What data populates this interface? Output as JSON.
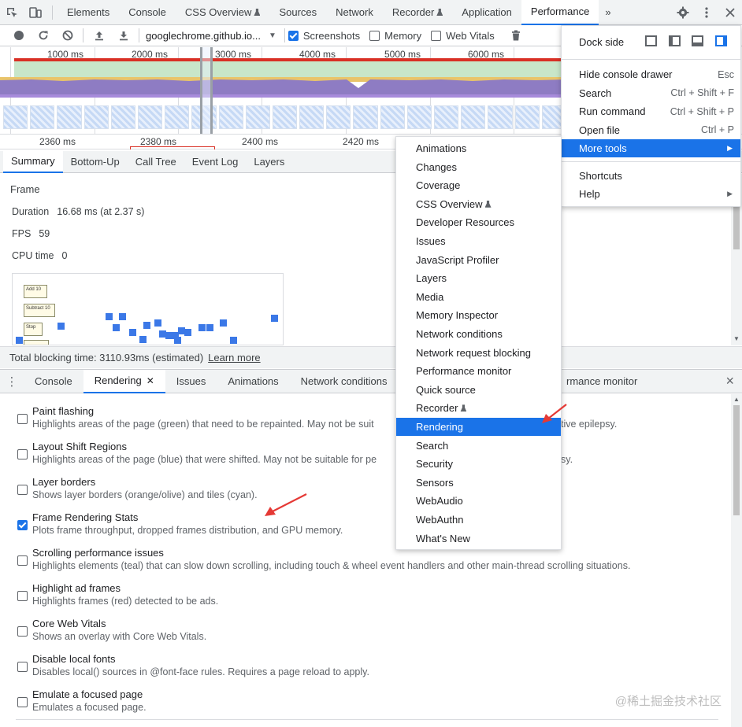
{
  "tabbar": {
    "tabs": [
      {
        "label": "Elements",
        "active": false
      },
      {
        "label": "Console",
        "active": false
      },
      {
        "label": "CSS Overview",
        "experimental": true,
        "active": false
      },
      {
        "label": "Sources",
        "active": false
      },
      {
        "label": "Network",
        "active": false
      },
      {
        "label": "Recorder",
        "experimental": true,
        "active": false
      },
      {
        "label": "Application",
        "active": false
      },
      {
        "label": "Performance",
        "active": true
      }
    ],
    "more": "»"
  },
  "perf_toolbar": {
    "url": "googlechrome.github.io...",
    "screenshots_label": "Screenshots",
    "screenshots_checked": true,
    "memory_label": "Memory",
    "memory_checked": false,
    "webvitals_label": "Web Vitals",
    "webvitals_checked": false
  },
  "overview_ruler": [
    "1000 ms",
    "2000 ms",
    "3000 ms",
    "4000 ms",
    "5000 ms",
    "6000 ms"
  ],
  "detail_ruler": [
    "2360 ms",
    "2380 ms",
    "2400 ms",
    "2420 ms"
  ],
  "subtabs": [
    "Summary",
    "Bottom-Up",
    "Call Tree",
    "Event Log",
    "Layers"
  ],
  "summary": {
    "heading": "Frame",
    "duration_label": "Duration",
    "duration_value": "16.68 ms (at 2.37 s)",
    "fps_label": "FPS",
    "fps_value": "59",
    "cpu_label": "CPU time",
    "cpu_value": "0",
    "thumb_buttons": [
      "Add 10",
      "Subtract 10",
      "Stop"
    ]
  },
  "footer": {
    "tbt_text": "Total blocking time: 3110.93ms (estimated)",
    "learn_more": "Learn more"
  },
  "drawer": {
    "tabs": [
      {
        "label": "Console",
        "active": false
      },
      {
        "label": "Rendering",
        "active": true,
        "closable": true
      },
      {
        "label": "Issues",
        "active": false
      },
      {
        "label": "Animations",
        "active": false
      },
      {
        "label": "Network conditions",
        "active": false
      }
    ],
    "trailing_tab": "rmance monitor",
    "close_x": "×"
  },
  "rendering_options": [
    {
      "title": "Paint flashing",
      "desc": "Highlights areas of the page (green) that need to be repainted. May not be suit",
      "tail": "tive epilepsy.",
      "checked": false
    },
    {
      "title": "Layout Shift Regions",
      "desc": "Highlights areas of the page (blue) that were shifted. May not be suitable for pe",
      "tail": "sy.",
      "checked": false
    },
    {
      "title": "Layer borders",
      "desc": "Shows layer borders (orange/olive) and tiles (cyan).",
      "tail": "",
      "checked": false
    },
    {
      "title": "Frame Rendering Stats",
      "desc": "Plots frame throughput, dropped frames distribution, and GPU memory.",
      "tail": "",
      "checked": true
    },
    {
      "title": "Scrolling performance issues",
      "desc": "Highlights elements (teal) that can slow down scrolling, including touch & wheel event handlers and other main-thread scrolling situations.",
      "tail": "",
      "checked": false
    },
    {
      "title": "Highlight ad frames",
      "desc": "Highlights frames (red) detected to be ads.",
      "tail": "",
      "checked": false
    },
    {
      "title": "Core Web Vitals",
      "desc": "Shows an overlay with Core Web Vitals.",
      "tail": "",
      "checked": false
    },
    {
      "title": "Disable local fonts",
      "desc": "Disables local() sources in @font-face rules. Requires a page reload to apply.",
      "tail": "",
      "checked": false
    },
    {
      "title": "Emulate a focused page",
      "desc": "Emulates a focused page.",
      "tail": "",
      "checked": false
    }
  ],
  "main_menu": {
    "dock_side": "Dock side",
    "items": [
      {
        "label": "Hide console drawer",
        "shortcut": "Esc"
      },
      {
        "label": "Search",
        "shortcut": "Ctrl + Shift + F"
      },
      {
        "label": "Run command",
        "shortcut": "Ctrl + Shift + P"
      },
      {
        "label": "Open file",
        "shortcut": "Ctrl + P"
      },
      {
        "label": "More tools",
        "shortcut": "",
        "submenu": true,
        "highlighted": true
      }
    ],
    "items2": [
      {
        "label": "Shortcuts"
      },
      {
        "label": "Help",
        "submenu": true
      }
    ]
  },
  "more_tools": [
    {
      "label": "Animations"
    },
    {
      "label": "Changes"
    },
    {
      "label": "Coverage"
    },
    {
      "label": "CSS Overview",
      "experimental": true
    },
    {
      "label": "Developer Resources"
    },
    {
      "label": "Issues"
    },
    {
      "label": "JavaScript Profiler"
    },
    {
      "label": "Layers"
    },
    {
      "label": "Media"
    },
    {
      "label": "Memory Inspector"
    },
    {
      "label": "Network conditions"
    },
    {
      "label": "Network request blocking"
    },
    {
      "label": "Performance monitor"
    },
    {
      "label": "Quick source"
    },
    {
      "label": "Recorder",
      "experimental": true
    },
    {
      "label": "Rendering",
      "highlighted": true
    },
    {
      "label": "Search"
    },
    {
      "label": "Security"
    },
    {
      "label": "Sensors"
    },
    {
      "label": "WebAudio"
    },
    {
      "label": "WebAuthn"
    },
    {
      "label": "What's New"
    }
  ],
  "watermark": "@稀土掘金技术社区",
  "colors": {
    "accent": "#1a73e8",
    "annotation_arrow": "#e53935",
    "frame_red": "#d93025"
  }
}
